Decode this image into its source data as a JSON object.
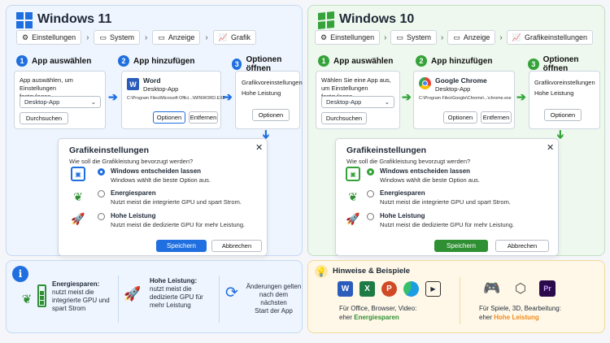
{
  "win11": {
    "title": "Windows 11",
    "breadcrumb": [
      "Einstellungen",
      "System",
      "Anzeige",
      "Grafik"
    ],
    "steps": [
      "App auswählen",
      "App hinzufügen",
      "Optionen öffnen"
    ],
    "step_numbers": [
      "1",
      "2",
      "3"
    ],
    "app_select": {
      "desc_line1": "App auswählen, um Einstellungen",
      "desc_line2": "festzulegen",
      "dropdown": "Desktop-App",
      "browse": "Durchsuchen"
    },
    "app_add": {
      "name": "Word",
      "type": "Desktop-App",
      "path": "C:\\Program Files\\Microsoft Offici...\\WINWORD.EXE",
      "options": "Optionen",
      "remove": "Entfernen"
    },
    "open_options": {
      "line1": "Grafikvoreinstellungen",
      "line2": "Hohe Leistung",
      "options": "Optionen"
    },
    "dialog": {
      "title": "Grafikeinstellungen",
      "question": "Wie soll die Grafikleistung bevorzugt werden?",
      "options": [
        {
          "title": "Windows entscheiden lassen",
          "desc": "Windows wählt die beste Option aus."
        },
        {
          "title": "Energiesparen",
          "desc": "Nutzt meist die integrierte GPU und spart Strom."
        },
        {
          "title": "Hohe Leistung",
          "desc": "Nutzt meist die dedizierte GPU für mehr Leistung."
        }
      ],
      "save": "Speichern",
      "cancel": "Abbrechen"
    }
  },
  "win10": {
    "title": "Windows 10",
    "breadcrumb": [
      "Einstellungen",
      "System",
      "Anzeige",
      "Grafikeinstellungen"
    ],
    "steps": [
      "App auswählen",
      "App hinzufügen",
      "Optionen öffnen"
    ],
    "step_numbers": [
      "1",
      "2",
      "3"
    ],
    "app_select": {
      "desc_line1": "Wählen Sie eine App aus,",
      "desc_line2": "um Einstellungen festzulegen.",
      "dropdown": "Desktop-App",
      "browse": "Durchsuchen"
    },
    "app_add": {
      "name": "Google Chrome",
      "type": "Desktop-App",
      "path": "C:\\Program Files\\Google\\Chrome\\...\\chrome.exe",
      "options": "Optionen",
      "remove": "Entfernen"
    },
    "open_options": {
      "line1": "Grafikvoreinstellungen",
      "line2": "Hohe Leistung",
      "options": "Optionen"
    },
    "dialog": {
      "title": "Grafikeinstellungen",
      "question": "Wie soll die Grafikleistung bevorzugt werden?",
      "options": [
        {
          "title": "Windows entscheiden lassen",
          "desc": "Windows wählt die beste Option aus."
        },
        {
          "title": "Energiesparen",
          "desc": "Nutzt meist die integrierte GPU und spart Strom."
        },
        {
          "title": "Hohe Leistung",
          "desc": "Nutzt meist die dedizierte GPU für mehr Leistung."
        }
      ],
      "save": "Speichern",
      "cancel": "Abbrechen"
    }
  },
  "info": {
    "energy": [
      "Energiesparen:",
      "nutzt meist die",
      "integrierte GPU und",
      "spart Strom"
    ],
    "performance": [
      "Hohe Leistung:",
      "nutzt meist die",
      "dedizierte GPU für",
      "mehr Leistung"
    ],
    "changes": [
      "Änderungen gelten",
      "nach dem nächsten",
      "Start der App"
    ]
  },
  "tips": {
    "title": "Hinweise & Beispiele",
    "office_line1": "Für Office, Browser, Video:",
    "office_prefix": "eher ",
    "office_highlight": "Energiesparen",
    "games_line1": "Für Spiele, 3D, Bearbeitung:",
    "games_prefix": "eher ",
    "games_highlight": "Hohe Leistung",
    "app_icons": [
      "word-icon",
      "excel-icon",
      "powerpoint-icon",
      "edge-icon",
      "video-player-icon"
    ],
    "heavy_icons": [
      "gamepad-icon",
      "3d-cube-icon",
      "premiere-pro-icon"
    ],
    "icon_letters": {
      "word": "W",
      "excel": "X",
      "powerpoint": "P",
      "premiere": "Pr"
    }
  },
  "colors": {
    "win11_accent": "#1f6fe0",
    "win10_accent": "#35a33a",
    "energy_green": "#2f8f33",
    "performance_orange": "#f08a1c"
  }
}
